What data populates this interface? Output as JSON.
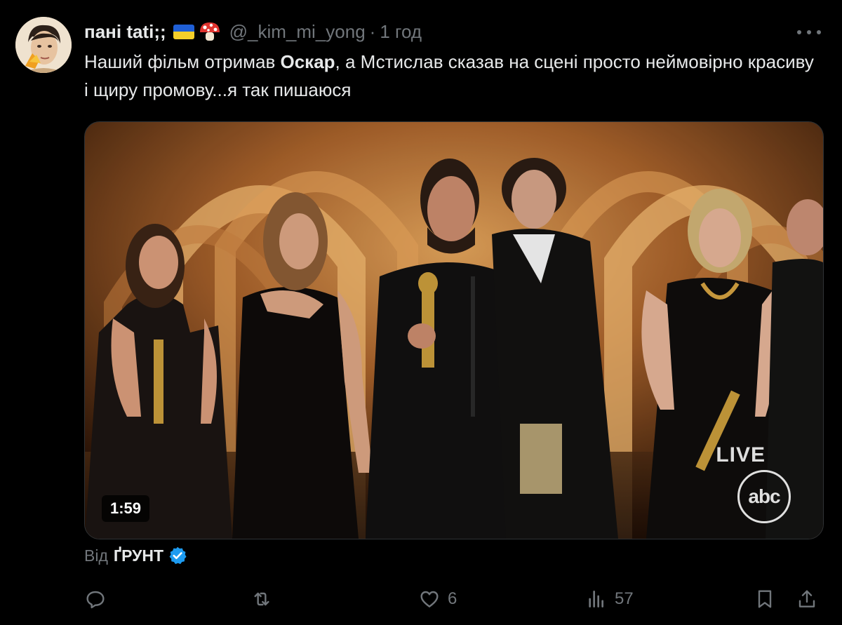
{
  "tweet": {
    "display_name": "пані tati;;",
    "handle": "@_kim_mi_yong",
    "separator": "·",
    "time": "1 год",
    "text_part1": "Наший фільм отримав ",
    "text_bold": "Оскар",
    "text_part2": ", а Мстислав сказав на сцені просто неймовірно красиву і щиру промову...я так пишаюся"
  },
  "media": {
    "duration": "1:59",
    "live_label": "LIVE",
    "network_logo": "abc"
  },
  "source": {
    "prefix": "Від",
    "name": "ҐРУНТ"
  },
  "actions": {
    "replies": "",
    "retweets": "",
    "likes": "6",
    "views": "57"
  },
  "colors": {
    "background": "#000000",
    "text_primary": "#e7e9ea",
    "text_secondary": "#71767b",
    "verified_blue": "#1d9bf0",
    "flag_blue": "#1f5fd6",
    "flag_yellow": "#f5cf2a"
  },
  "icons": [
    "more-icon",
    "reply-icon",
    "retweet-icon",
    "like-icon",
    "views-icon",
    "bookmark-icon",
    "share-icon",
    "verified-icon",
    "ukraine-flag-icon",
    "mushroom-icon"
  ]
}
